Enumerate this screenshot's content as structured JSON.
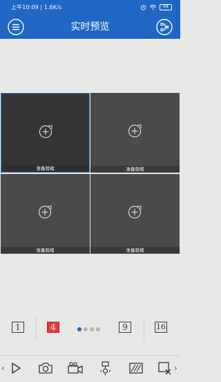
{
  "status": {
    "time": "上午10:09 | 1.6K/s",
    "battery": "98"
  },
  "header": {
    "title": "实时预览"
  },
  "tiles": [
    {
      "label": "准备就绪",
      "selected": true
    },
    {
      "label": "准备就绪",
      "selected": false
    },
    {
      "label": "准备就绪",
      "selected": false
    },
    {
      "label": "准备就绪",
      "selected": false
    }
  ],
  "layout": {
    "options": [
      "1",
      "4",
      "9",
      "16"
    ],
    "active": "4",
    "pages": 4,
    "current_page": 1
  },
  "toolbar": {
    "icons": [
      "play-icon",
      "camera-icon",
      "record-video-icon",
      "ptz-icon",
      "image-quality-icon",
      "close-all-icon"
    ]
  },
  "colors": {
    "header": "#1f67c2",
    "active_layout": "#e23c3c"
  }
}
